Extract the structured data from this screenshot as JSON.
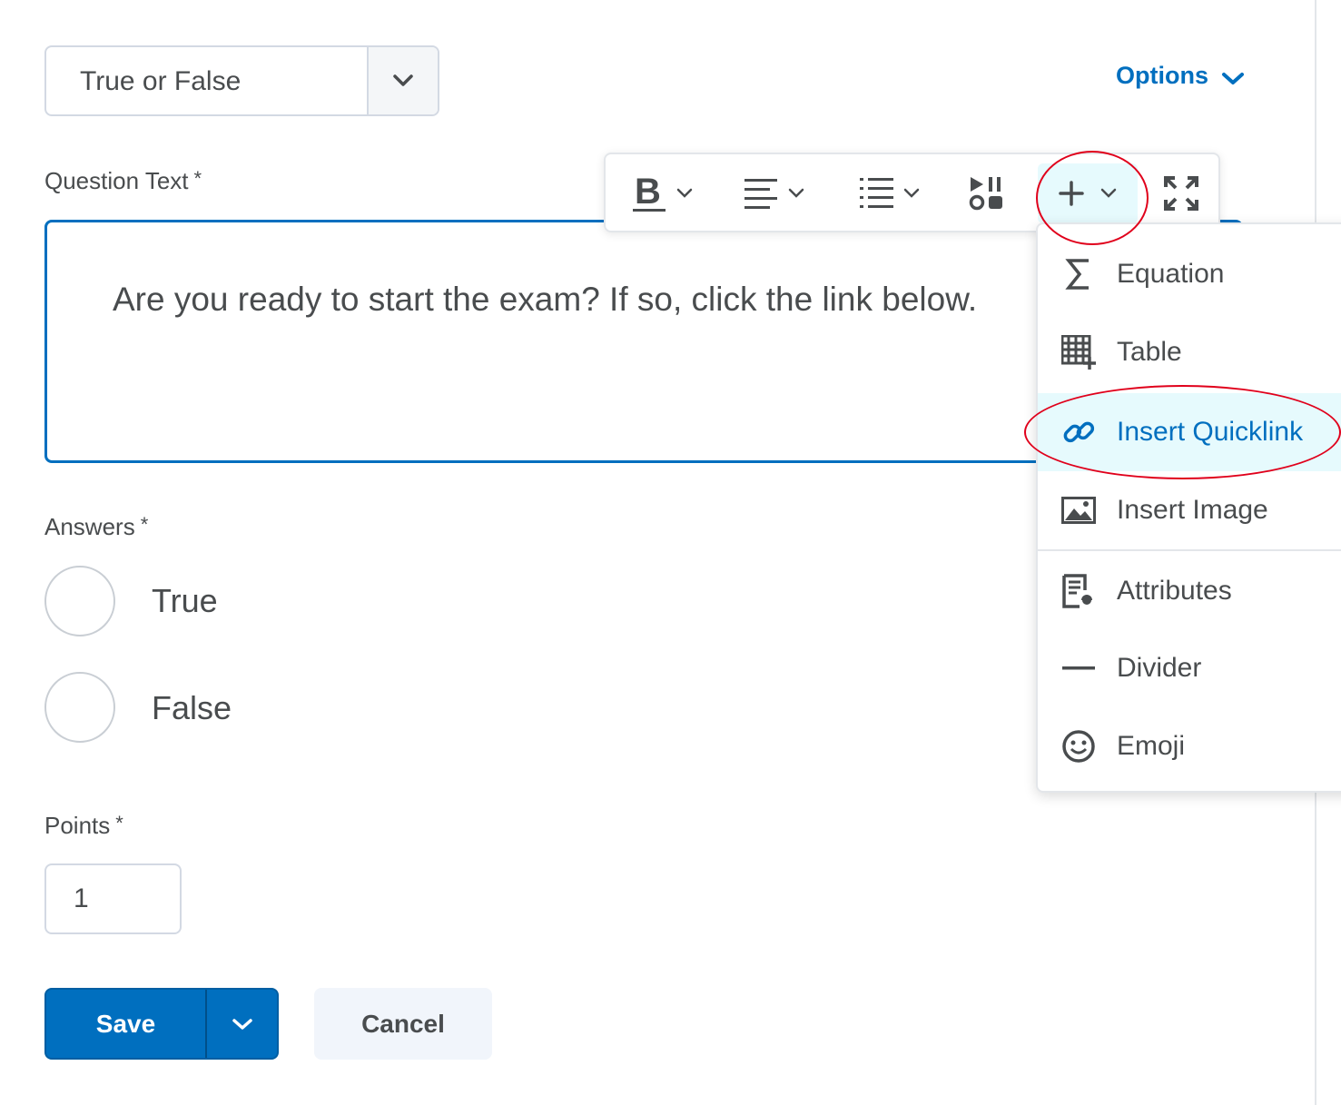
{
  "question_type": {
    "selected": "True or False"
  },
  "options_link": {
    "label": "Options"
  },
  "question_text": {
    "label": "Question Text",
    "required_marker": "*",
    "content": "Are you ready to start the exam? If so, click the link below."
  },
  "toolbar": {
    "buttons": [
      {
        "name": "bold",
        "icon": "bold-icon"
      },
      {
        "name": "alignment",
        "icon": "align-left-icon"
      },
      {
        "name": "list",
        "icon": "bulleted-list-icon"
      },
      {
        "name": "media",
        "icon": "insert-stuff-icon"
      },
      {
        "name": "insert",
        "icon": "plus-icon",
        "active": true
      },
      {
        "name": "fullscreen",
        "icon": "fullscreen-icon"
      }
    ]
  },
  "insert_menu": {
    "items": [
      {
        "label": "Equation",
        "icon": "sigma-icon"
      },
      {
        "label": "Table",
        "icon": "table-icon"
      },
      {
        "label": "Insert Quicklink",
        "icon": "link-icon",
        "highlighted": true
      },
      {
        "label": "Insert Image",
        "icon": "image-icon"
      },
      {
        "label": "Attributes",
        "icon": "attributes-icon"
      },
      {
        "label": "Divider",
        "icon": "divider-icon"
      },
      {
        "label": "Emoji",
        "icon": "emoji-icon"
      }
    ]
  },
  "answers": {
    "label": "Answers",
    "required_marker": "*",
    "options": [
      {
        "label": "True"
      },
      {
        "label": "False"
      }
    ]
  },
  "points": {
    "label": "Points",
    "required_marker": "*",
    "value": "1"
  },
  "actions": {
    "save_label": "Save",
    "cancel_label": "Cancel"
  },
  "colors": {
    "accent": "#006fbf",
    "highlight_bg": "#e6fafd",
    "annotation": "#e0001b"
  }
}
